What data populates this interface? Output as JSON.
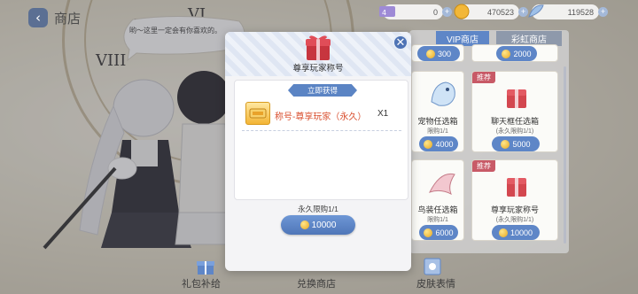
{
  "header": {
    "back_icon": "chevron-left-icon",
    "title": "商店"
  },
  "resources": [
    {
      "icon": "ticket-icon",
      "value": "0"
    },
    {
      "icon": "gold-coin-icon",
      "value": "470523"
    },
    {
      "icon": "feather-gem-icon",
      "value": "119528"
    }
  ],
  "speech_bubble": "哟～这里一定会有你喜欢的。",
  "shop_tabs": [
    {
      "label": "VIP商店"
    },
    {
      "label": "彩虹商店"
    }
  ],
  "shop_items": [
    {
      "name": "",
      "limit": "",
      "price": "300",
      "badge": ""
    },
    {
      "name": "",
      "limit": "",
      "price": "2000",
      "badge": ""
    },
    {
      "name": "宠物任选箱",
      "limit": "限购1/1",
      "price": "4000",
      "badge": ""
    },
    {
      "name": "聊天框任选箱",
      "limit": "(永久限购1/1)",
      "price": "5000",
      "badge": "推荐"
    },
    {
      "name": "鸟装任选箱",
      "limit": "限购1/1",
      "price": "6000",
      "badge": ""
    },
    {
      "name": "尊享玩家称号",
      "limit": "(永久限购1/1)",
      "price": "10000",
      "badge": "推荐"
    }
  ],
  "bottom_nav": [
    {
      "label": "礼包补给",
      "icon": "gift-icon"
    },
    {
      "label": "兑换商店",
      "icon": ""
    },
    {
      "label": "皮肤表情",
      "icon": "emoji-card-icon"
    }
  ],
  "modal": {
    "title": "尊享玩家称号",
    "obtain_label": "立即获得",
    "reward_name": "称号-尊享玩家（永久）",
    "reward_qty": "X1",
    "limit_text": "永久限购1/1",
    "price": "10000",
    "close_icon": "close-icon",
    "box_icon": "gift-box-icon"
  },
  "colors": {
    "accent_blue": "#5e86c7",
    "badge_red": "#c85a67",
    "reward_text": "#d94f2f"
  }
}
